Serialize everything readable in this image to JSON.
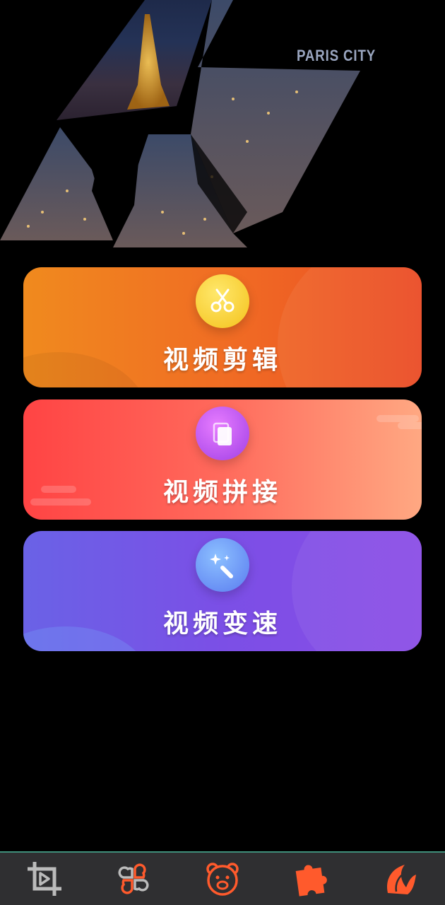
{
  "banner": {
    "caption": "PARIS CITY"
  },
  "cards": [
    {
      "label": "视频剪辑",
      "icon": "scissors-icon",
      "color_start": "#f08a1e",
      "color_end": "#ea4a24"
    },
    {
      "label": "视频拼接",
      "icon": "copy-pages-icon",
      "color_start": "#ff4444",
      "color_end": "#ffa882"
    },
    {
      "label": "视频变速",
      "icon": "magic-wand-icon",
      "color_start": "#6a62e6",
      "color_end": "#8a4ce6"
    }
  ],
  "bottom_nav": {
    "items": [
      {
        "icon": "crop-play-icon",
        "active": false
      },
      {
        "icon": "clover-hearts-icon",
        "active": false
      },
      {
        "icon": "bear-face-icon",
        "active": false
      },
      {
        "icon": "puzzle-icon",
        "active": false
      },
      {
        "icon": "flame-swirl-icon",
        "active": true
      }
    ],
    "accent": "#ff5a2c",
    "inactive": "#bbbbbb"
  }
}
